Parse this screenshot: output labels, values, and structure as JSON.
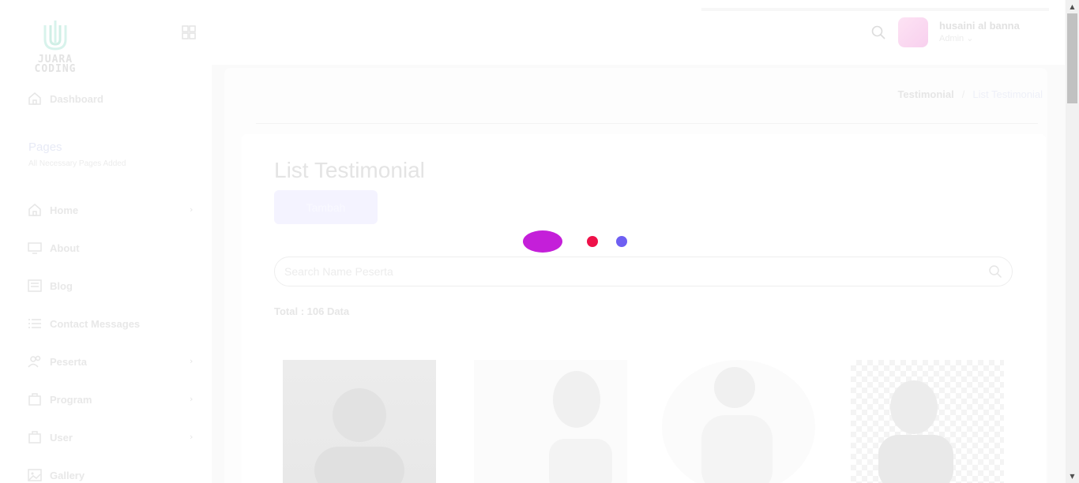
{
  "brand": {
    "logo_text_line1": "JUARA",
    "logo_text_line2": "CODING"
  },
  "sidebar": {
    "items_top": [
      {
        "label": "Dashboard",
        "icon": "home-icon"
      }
    ],
    "section": {
      "title": "Pages",
      "subtitle": "All Necessary Pages Added"
    },
    "items": [
      {
        "label": "Home",
        "icon": "home-icon",
        "has_children": true
      },
      {
        "label": "About",
        "icon": "monitor-icon",
        "has_children": false
      },
      {
        "label": "Blog",
        "icon": "newspaper-icon",
        "has_children": false
      },
      {
        "label": "Contact Messages",
        "icon": "list-icon",
        "has_children": false
      },
      {
        "label": "Peserta",
        "icon": "users-icon",
        "has_children": true
      },
      {
        "label": "Program",
        "icon": "building-icon",
        "has_children": true
      },
      {
        "label": "User",
        "icon": "building-icon",
        "has_children": true
      },
      {
        "label": "Gallery",
        "icon": "image-icon",
        "has_children": false
      }
    ]
  },
  "header": {
    "user_name": "husaini al banna",
    "user_role": "Admin"
  },
  "breadcrumb": {
    "parent": "Testimonial",
    "separator": "/",
    "current": "List Testimonial"
  },
  "main": {
    "title": "List Testimonial",
    "add_button": "Tambah",
    "search_placeholder": "Search Name Peserta",
    "total_text": "Total : 106 Data"
  },
  "colors": {
    "loader_purple": "#c41fd9",
    "loader_red": "#ee1149",
    "loader_blue": "#6e5ff2"
  }
}
